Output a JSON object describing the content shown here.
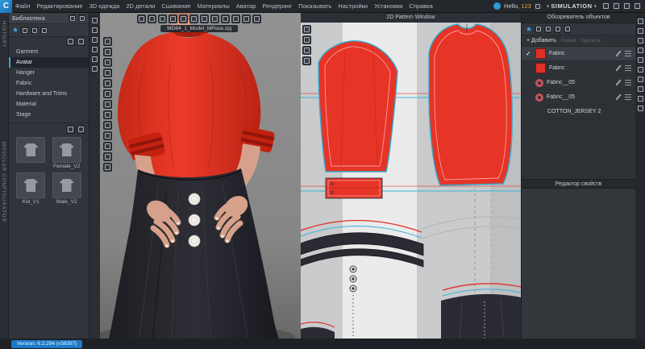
{
  "app": {
    "logo_letter": "C",
    "version": "Version: 6.2.294 (v38397)"
  },
  "menubar": [
    "Файл",
    "Редактирование",
    "3D одежда",
    "2D детали",
    "Сшивание",
    "Материалы",
    "Аватар",
    "Рендеринг",
    "Показывать",
    "Настройки",
    "Установки",
    "Справка"
  ],
  "topbar": {
    "greeting": "Hello,",
    "username": "123",
    "simulation_label": "SIMULATION"
  },
  "rails": {
    "history": "HISTORY",
    "modular_configurator": "MODULAR CONFIGURATOR"
  },
  "library": {
    "title": "Библиотека",
    "items": [
      {
        "label": "Garment"
      },
      {
        "label": "Avatar"
      },
      {
        "label": "Hanger"
      },
      {
        "label": "Fabric"
      },
      {
        "label": "Hardware and Trims"
      },
      {
        "label": "Material"
      },
      {
        "label": "Stage"
      }
    ],
    "selected_item": "Avatar",
    "thumbnails": [
      {
        "label": ""
      },
      {
        "label": "Female_V2"
      },
      {
        "label": "Kid_V1"
      },
      {
        "label": "Male_V2"
      }
    ]
  },
  "viewport3d": {
    "filename": "MD84_1_Model_MPose.zpj"
  },
  "pattern2d": {
    "title": "2D Pattern Window"
  },
  "object_browser": {
    "title": "Обозреватель объектов",
    "add_label": "+ Добавить",
    "action_copy": "Копия",
    "action_delete": "Удалить",
    "items": [
      {
        "name": "Fabric",
        "selected": true
      },
      {
        "name": "Fabric",
        "selected": false
      },
      {
        "name": "Fabric__05",
        "selected": false
      },
      {
        "name": "Fabric__05",
        "selected": false
      },
      {
        "name": "COTTON_JERSEY 2",
        "selected": false
      }
    ]
  },
  "property_editor": {
    "title": "Редактор свойств"
  },
  "icons": {
    "check": "✓",
    "star": "★",
    "caret_down": "▾"
  },
  "colors": {
    "accent_blue": "#2f9bd8",
    "fabric_red": "#e63426",
    "pattern_outline": "#2facd0",
    "guide_red": "#e0302a",
    "guide_cyan": "#38b4d8"
  }
}
